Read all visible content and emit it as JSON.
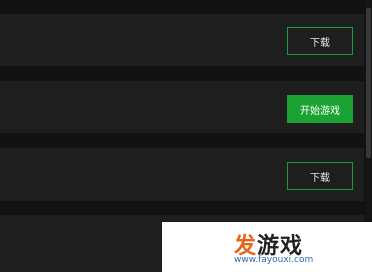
{
  "rows": [
    {
      "button_label": "下载"
    },
    {
      "button_label": "开始游戏"
    },
    {
      "button_label": "下载"
    }
  ],
  "watermark": {
    "title_part1": "发",
    "title_part2": "游戏",
    "url": "www.fayouxi.com"
  },
  "colors": {
    "accent": "#1aa332",
    "outline": "#1d9a3a",
    "background": "#121212",
    "row_background": "#1e1e1e"
  }
}
